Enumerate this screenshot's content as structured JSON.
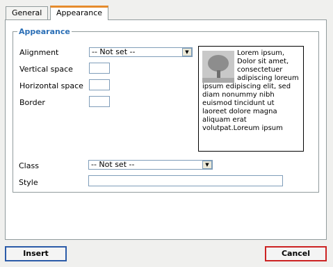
{
  "tabs": [
    {
      "label": "General"
    },
    {
      "label": "Appearance"
    }
  ],
  "appearance": {
    "legend": "Appearance",
    "alignment": {
      "label": "Alignment",
      "value": "-- Not set --"
    },
    "vertical_space": {
      "label": "Vertical space",
      "value": ""
    },
    "horizontal_space": {
      "label": "Horizontal space",
      "value": ""
    },
    "border": {
      "label": "Border",
      "value": ""
    },
    "preview_text": "Lorem ipsum, Dolor sit amet, consectetuer adipiscing loreum ipsum edipiscing elit, sed diam nonummy nibh euismod tincidunt ut laoreet dolore magna aliquam erat volutpat.Loreum ipsum"
  },
  "class_field": {
    "label": "Class",
    "value": "-- Not set --"
  },
  "style_field": {
    "label": "Style",
    "value": ""
  },
  "buttons": {
    "insert": "Insert",
    "cancel": "Cancel"
  },
  "colors": {
    "accent_tab": "#e68b2c",
    "legend": "#2b6fb6",
    "insert_border": "#2b5ba8",
    "cancel_border": "#cc2222"
  },
  "icons": {
    "dropdown": "triangle-down",
    "preview_image": "tree-thumbnail"
  }
}
